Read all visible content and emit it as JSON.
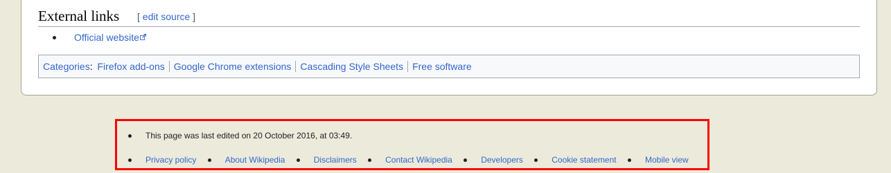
{
  "section": {
    "title": "External links",
    "edit_open": "[",
    "edit_label": "edit source",
    "edit_close": "]"
  },
  "external_links": [
    {
      "label": "Official website",
      "icon": "external-link-icon"
    }
  ],
  "categories": {
    "label": "Categories",
    "separator": ":",
    "items": [
      "Firefox add-ons",
      "Google Chrome extensions",
      "Cascading Style Sheets",
      "Free software"
    ]
  },
  "footer": {
    "last_edited": "This page was last edited on 20 October 2016, at 03:49.",
    "places": [
      "Privacy policy",
      "About Wikipedia",
      "Disclaimers",
      "Contact Wikipedia",
      "Developers",
      "Cookie statement",
      "Mobile view"
    ]
  },
  "colors": {
    "page_background": "#ecebdb",
    "link": "#3366cc",
    "highlight_border": "#ff0000"
  }
}
